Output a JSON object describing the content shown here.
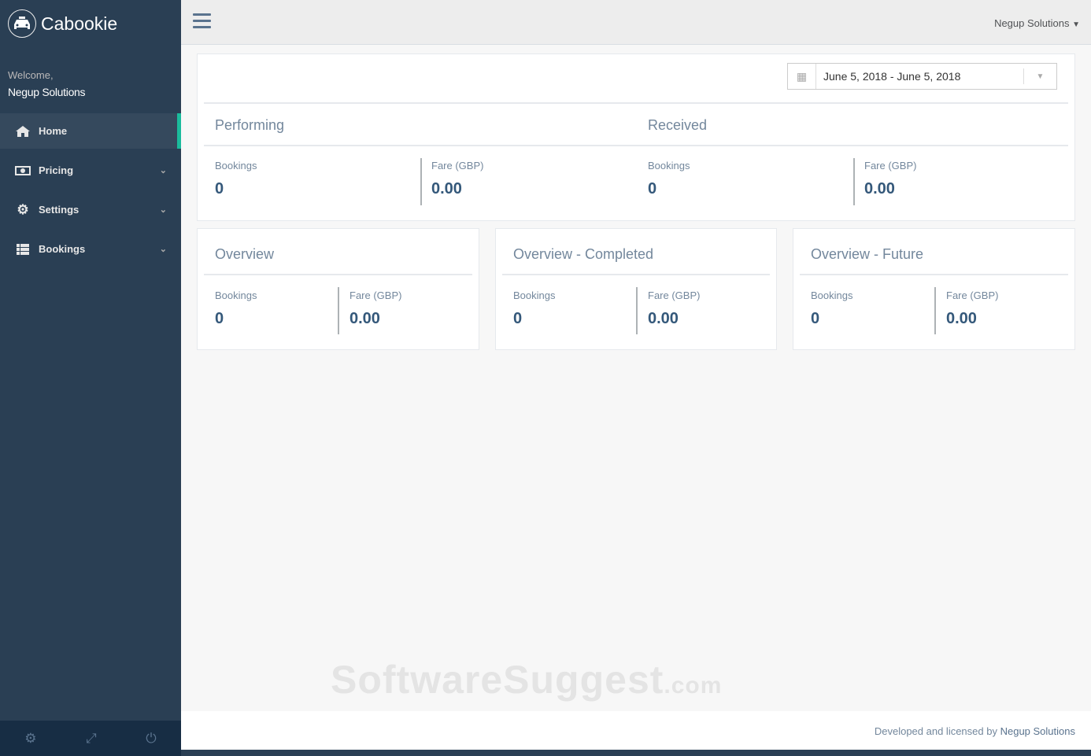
{
  "brand": "Cabookie",
  "welcome": "Welcome,",
  "user": "Negup Solutions",
  "nav": [
    {
      "label": "Home",
      "icon": "home-icon"
    },
    {
      "label": "Pricing",
      "icon": "money-icon"
    },
    {
      "label": "Settings",
      "icon": "gear-icon"
    },
    {
      "label": "Bookings",
      "icon": "list-icon"
    }
  ],
  "topbar": {
    "user_menu": "Negup Solutions"
  },
  "date_range": "June 5, 2018 - June 5, 2018",
  "performing": {
    "title": "Performing",
    "bookings_label": "Bookings",
    "bookings": "0",
    "fare_label": "Fare (GBP)",
    "fare": "0.00"
  },
  "received": {
    "title": "Received",
    "bookings_label": "Bookings",
    "bookings": "0",
    "fare_label": "Fare (GBP)",
    "fare": "0.00"
  },
  "cards": [
    {
      "title": "Overview",
      "bookings_label": "Bookings",
      "bookings": "0",
      "fare_label": "Fare (GBP)",
      "fare": "0.00"
    },
    {
      "title": "Overview - Completed",
      "bookings_label": "Bookings",
      "bookings": "0",
      "fare_label": "Fare (GBP)",
      "fare": "0.00"
    },
    {
      "title": "Overview - Future",
      "bookings_label": "Bookings",
      "bookings": "0",
      "fare_label": "Fare (GBP)",
      "fare": "0.00"
    }
  ],
  "footer": {
    "text": "Developed and licensed by",
    "company": "Negup Solutions"
  },
  "watermark": {
    "main": "SoftwareSuggest",
    "suffix": ".com"
  }
}
